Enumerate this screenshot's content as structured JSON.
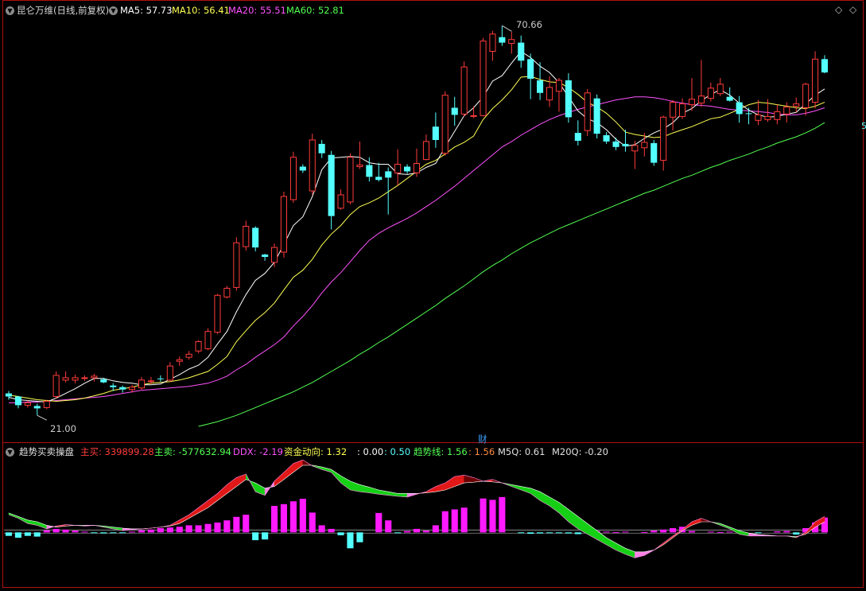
{
  "colors": {
    "up": "#ff3b3b",
    "down": "#54ffff",
    "ma5": "#ffffff",
    "ma10": "#ffff52",
    "ma20": "#ff52ff",
    "ma60": "#52ff52",
    "frame": "#b01010",
    "bg": "#000000"
  },
  "header": {
    "title": "昆仑万维(日线,前复权)",
    "ma5_label": "MA5:",
    "ma5_value": "57.73",
    "ma10_label": "MA10:",
    "ma10_value": "56.41",
    "ma20_label": "MA20:",
    "ma20_value": "55.51",
    "ma60_label": "MA60:",
    "ma60_value": "52.81"
  },
  "price_axis_mark": "5",
  "diamond_icon": "◇",
  "markers": {
    "high_label": "70.66",
    "low_label": "21.00",
    "event_label": "财"
  },
  "indicator_header": {
    "name": "趋势买卖操盘",
    "buy_label": "主买:",
    "buy_value": "339899.28",
    "sell_label": "主卖:",
    "sell_value": "-577632.94",
    "ddx_label": "DDX:",
    "ddx_value": "-2.19",
    "flow_label": "资金动向:",
    "flow_value": "1.32",
    "blank1_label": ":",
    "blank1_value": "0.00",
    "blank2_label": ":",
    "blank2_value": "0.50",
    "trend_label": "趋势线:",
    "trend_value": "1.56",
    "blank3_label": ":",
    "blank3_value": "1.56",
    "m5q_label": "M5Q:",
    "m5q_value": "0.61",
    "m20q_label": "M20Q:",
    "m20q_value": "-0.20"
  },
  "chart_data": {
    "type": "candlestick",
    "y_range": [
      19.4,
      71.3
    ],
    "ohlc": [
      [
        23.8,
        24.1,
        23.0,
        23.4
      ],
      [
        23.4,
        23.5,
        21.9,
        22.3
      ],
      [
        22.3,
        22.9,
        22.0,
        22.6
      ],
      [
        22.2,
        22.5,
        21.0,
        21.9
      ],
      [
        22.0,
        23.0,
        21.8,
        22.8
      ],
      [
        23.4,
        26.6,
        23.1,
        26.1
      ],
      [
        25.5,
        26.6,
        25.2,
        25.8
      ],
      [
        25.5,
        26.2,
        25.1,
        25.8
      ],
      [
        25.8,
        26.1,
        25.4,
        25.8
      ],
      [
        25.8,
        26.3,
        25.3,
        26.0
      ],
      [
        25.6,
        25.8,
        25.1,
        25.2
      ],
      [
        24.8,
        25.1,
        24.1,
        24.6
      ],
      [
        24.6,
        24.8,
        23.9,
        24.3
      ],
      [
        24.3,
        24.9,
        23.9,
        24.6
      ],
      [
        24.5,
        25.9,
        24.3,
        25.5
      ],
      [
        25.3,
        25.9,
        25.0,
        25.4
      ],
      [
        25.7,
        26.1,
        25.3,
        25.6
      ],
      [
        25.5,
        27.8,
        25.3,
        27.3
      ],
      [
        27.9,
        28.5,
        27.3,
        28.1
      ],
      [
        28.4,
        29.2,
        28.1,
        28.8
      ],
      [
        29.2,
        30.6,
        28.9,
        30.4
      ],
      [
        29.5,
        32.1,
        29.3,
        31.7
      ],
      [
        31.6,
        36.5,
        31.4,
        36.3
      ],
      [
        36.1,
        37.5,
        35.9,
        37.2
      ],
      [
        37.3,
        43.7,
        36.9,
        43.0
      ],
      [
        42.5,
        45.8,
        42.0,
        45.1
      ],
      [
        44.9,
        45.1,
        41.9,
        42.4
      ],
      [
        41.5,
        41.6,
        40.7,
        41.2
      ],
      [
        40.5,
        42.9,
        39.9,
        42.4
      ],
      [
        41.8,
        49.5,
        41.1,
        48.9
      ],
      [
        48.5,
        54.6,
        48.1,
        53.9
      ],
      [
        52.7,
        53.0,
        51.9,
        52.2
      ],
      [
        49.6,
        56.9,
        49.1,
        56.1
      ],
      [
        55.6,
        56.1,
        53.8,
        54.4
      ],
      [
        54.2,
        54.7,
        44.7,
        46.4
      ],
      [
        47.4,
        49.8,
        47.2,
        49.1
      ],
      [
        48.2,
        54.4,
        47.9,
        53.9
      ],
      [
        52.7,
        55.9,
        52.4,
        52.9
      ],
      [
        52.9,
        53.9,
        50.8,
        51.4
      ],
      [
        51.4,
        53.2,
        50.8,
        51.0
      ],
      [
        52.1,
        52.6,
        46.6,
        51.3
      ],
      [
        51.9,
        54.9,
        50.3,
        53.0
      ],
      [
        52.7,
        53.0,
        51.8,
        52.1
      ],
      [
        51.9,
        55.0,
        51.4,
        53.1
      ],
      [
        53.6,
        56.8,
        53.5,
        55.9
      ],
      [
        57.8,
        59.6,
        55.1,
        56.1
      ],
      [
        54.4,
        62.3,
        54.1,
        61.8
      ],
      [
        60.2,
        61.6,
        57.9,
        59.3
      ],
      [
        59.4,
        66.1,
        59.1,
        65.4
      ],
      [
        59.2,
        60.4,
        58.9,
        59.2
      ],
      [
        59.2,
        69.1,
        59.1,
        68.7
      ],
      [
        67.4,
        70.0,
        66.2,
        69.6
      ],
      [
        69.2,
        70.66,
        68.1,
        68.5
      ],
      [
        68.4,
        69.9,
        67.1,
        68.9
      ],
      [
        68.5,
        69.4,
        65.3,
        66.2
      ],
      [
        66.4,
        67.1,
        61.3,
        63.9
      ],
      [
        63.7,
        66.0,
        61.2,
        62.1
      ],
      [
        61.2,
        64.2,
        60.3,
        62.8
      ],
      [
        62.3,
        64.0,
        59.7,
        63.7
      ],
      [
        63.7,
        64.6,
        58.3,
        59.0
      ],
      [
        57.0,
        58.6,
        55.4,
        56.0
      ],
      [
        57.3,
        62.6,
        56.6,
        62.1
      ],
      [
        61.4,
        61.9,
        56.3,
        56.9
      ],
      [
        56.7,
        57.1,
        55.6,
        55.9
      ],
      [
        55.9,
        56.4,
        54.8,
        55.2
      ],
      [
        55.6,
        57.4,
        54.6,
        55.3
      ],
      [
        54.7,
        56.0,
        52.4,
        55.4
      ],
      [
        55.1,
        57.0,
        54.0,
        55.8
      ],
      [
        55.7,
        56.1,
        52.8,
        53.2
      ],
      [
        53.5,
        59.2,
        52.2,
        59.0
      ],
      [
        59.0,
        61.2,
        57.3,
        60.9
      ],
      [
        59.1,
        61.4,
        58.8,
        60.7
      ],
      [
        60.6,
        64.0,
        59.8,
        61.3
      ],
      [
        60.8,
        66.3,
        60.3,
        61.7
      ],
      [
        61.4,
        63.4,
        61.0,
        62.7
      ],
      [
        62.0,
        64.0,
        61.7,
        63.2
      ],
      [
        61.6,
        62.8,
        61.0,
        61.1
      ],
      [
        60.9,
        61.7,
        58.3,
        59.4
      ],
      [
        59.5,
        60.2,
        58.1,
        59.4
      ],
      [
        58.6,
        61.2,
        58.0,
        59.3
      ],
      [
        58.7,
        61.3,
        58.4,
        59.1
      ],
      [
        58.7,
        60.6,
        58.1,
        59.7
      ],
      [
        59.4,
        60.9,
        58.3,
        60.3
      ],
      [
        60.4,
        61.5,
        59.6,
        60.7
      ],
      [
        60.2,
        63.4,
        59.2,
        63.2
      ],
      [
        60.9,
        67.4,
        60.1,
        66.4
      ],
      [
        66.4,
        66.9,
        64.6,
        64.7
      ]
    ],
    "ma5": [
      23.3,
      23.0,
      22.9,
      22.8,
      22.7,
      23.2,
      23.8,
      24.4,
      25.1,
      25.7,
      25.7,
      25.4,
      25.2,
      25.1,
      24.9,
      24.9,
      25.0,
      25.6,
      26.2,
      26.9,
      27.4,
      28.4,
      30.1,
      31.7,
      34.2,
      36.4,
      38.2,
      39.1,
      40.5,
      42.8,
      45.2,
      46.3,
      48.9,
      52.3,
      53.8,
      53.9,
      54.0,
      53.9,
      53.2,
      53.0,
      53.0,
      51.8,
      51.7,
      51.9,
      52.6,
      53.1,
      55.2,
      57.2,
      59.2,
      60.2,
      61.6,
      63.6,
      64.3,
      65.9,
      67.4,
      66.6,
      65.5,
      64.7,
      63.4,
      61.6,
      59.8,
      58.8,
      58.3,
      57.4,
      56.2,
      55.3,
      55.5,
      56.3,
      57.0,
      57.5,
      58.3,
      59.5,
      60.1,
      61.1,
      61.9,
      62.5,
      61.8,
      60.8,
      59.9,
      59.3,
      59.0,
      59.1,
      59.4,
      59.6,
      60.7,
      61.8,
      62.6
    ],
    "ma10": [
      23.6,
      23.4,
      23.2,
      23.0,
      22.9,
      22.8,
      22.9,
      23.0,
      23.2,
      23.5,
      23.8,
      24.2,
      24.4,
      24.6,
      24.9,
      25.1,
      25.2,
      25.3,
      25.5,
      25.8,
      26.2,
      26.6,
      27.5,
      28.5,
      30.4,
      31.8,
      33.1,
      34.1,
      35.3,
      37.0,
      38.6,
      39.5,
      40.9,
      42.7,
      44.1,
      45.2,
      46.6,
      47.6,
      48.1,
      48.7,
      49.5,
      50.3,
      51.2,
      52.1,
      53.0,
      53.5,
      54.3,
      55.2,
      55.8,
      56.6,
      58.7,
      60.1,
      61.2,
      62.5,
      64.1,
      64.2,
      63.8,
      63.5,
      63.4,
      62.8,
      61.9,
      60.9,
      60.3,
      59.5,
      58.4,
      57.1,
      56.8,
      56.6,
      56.4,
      56.5,
      57.0,
      57.4,
      57.8,
      58.3,
      58.8,
      59.0,
      59.5,
      60.0,
      60.6,
      60.9,
      60.8,
      60.6,
      60.4,
      60.2,
      60.1,
      60.4,
      60.9
    ],
    "ma20": [
      22.6,
      22.6,
      22.7,
      22.7,
      22.8,
      22.9,
      23.0,
      23.1,
      23.2,
      23.3,
      23.4,
      23.6,
      23.8,
      24.0,
      24.2,
      24.3,
      24.4,
      24.5,
      24.6,
      24.7,
      24.9,
      25.1,
      25.5,
      26.0,
      26.8,
      27.5,
      28.4,
      29.2,
      30.0,
      31.0,
      32.4,
      33.6,
      35.0,
      36.6,
      38.0,
      39.2,
      40.6,
      42.0,
      43.3,
      44.2,
      44.9,
      45.5,
      46.1,
      46.8,
      47.6,
      48.4,
      49.3,
      50.2,
      51.2,
      52.2,
      53.2,
      54.2,
      55.2,
      55.9,
      56.7,
      57.4,
      58.1,
      58.7,
      59.2,
      59.6,
      60.0,
      60.3,
      60.6,
      60.9,
      61.2,
      61.4,
      61.6,
      61.6,
      61.5,
      61.3,
      61.0,
      60.8,
      60.6,
      60.5,
      60.4,
      60.2,
      60.0,
      59.9,
      59.8,
      59.7,
      59.6,
      59.4,
      59.3,
      59.3,
      59.5,
      59.8,
      60.2
    ],
    "ma60": [
      null,
      null,
      null,
      null,
      null,
      null,
      null,
      null,
      null,
      null,
      null,
      null,
      null,
      null,
      null,
      null,
      null,
      null,
      null,
      null,
      19.6,
      19.9,
      20.2,
      20.6,
      21.0,
      21.5,
      22.0,
      22.5,
      23.0,
      23.5,
      24.0,
      24.6,
      25.2,
      25.9,
      26.6,
      27.3,
      28.0,
      28.8,
      29.5,
      30.3,
      31.0,
      31.8,
      32.6,
      33.4,
      34.2,
      35.0,
      35.9,
      36.7,
      37.5,
      38.4,
      39.3,
      40.1,
      40.8,
      41.6,
      42.3,
      43.0,
      43.6,
      44.2,
      44.8,
      45.3,
      45.8,
      46.3,
      46.8,
      47.3,
      47.8,
      48.3,
      48.8,
      49.3,
      49.7,
      50.2,
      50.7,
      51.2,
      51.6,
      52.1,
      52.6,
      53.0,
      53.5,
      53.9,
      54.3,
      54.8,
      55.2,
      55.7,
      56.1,
      56.5,
      57.0,
      57.6,
      58.3
    ],
    "indicator": {
      "y_range": [
        -1.5,
        2.1
      ],
      "bars": [
        -0.1,
        -0.15,
        -0.1,
        -0.12,
        0.06,
        0.1,
        0.08,
        0.05,
        0.02,
        -0.02,
        -0.03,
        -0.02,
        -0.01,
        0.02,
        0.06,
        0.08,
        0.12,
        0.14,
        0.16,
        0.2,
        0.2,
        0.24,
        0.28,
        0.34,
        0.44,
        0.5,
        -0.22,
        -0.2,
        0.75,
        0.8,
        0.88,
        0.95,
        0.56,
        0.2,
        0.1,
        -0.08,
        -0.45,
        -0.28,
        0.0,
        0.55,
        0.34,
        -0.02,
        0.04,
        0.1,
        0.05,
        0.2,
        0.6,
        0.65,
        0.7,
        0.0,
        0.96,
        0.92,
        1.0,
        0.0,
        -0.02,
        -0.04,
        -0.03,
        -0.02,
        -0.02,
        -0.03,
        -0.05,
        0.01,
        0.04,
        0.02,
        0.01,
        0.02,
        0.0,
        0.01,
        0.05,
        0.08,
        0.12,
        0.16,
        0.04,
        0.0,
        0.02,
        0.01,
        0.02,
        0.0,
        0.0,
        -0.02,
        0.0,
        0.03,
        0.04,
        -0.06,
        0.12,
        0.28,
        0.42
      ],
      "main": [
        0.5,
        0.4,
        0.25,
        0.2,
        0.1,
        0.18,
        0.22,
        0.2,
        0.18,
        0.2,
        0.15,
        0.1,
        0.05,
        0.08,
        0.1,
        0.12,
        0.15,
        0.2,
        0.35,
        0.5,
        0.7,
        0.9,
        1.1,
        1.35,
        1.55,
        1.65,
        1.15,
        1.05,
        1.45,
        1.7,
        1.95,
        2.05,
        1.88,
        1.78,
        1.7,
        1.4,
        1.2,
        1.15,
        1.12,
        1.08,
        1.05,
        1.02,
        1.0,
        1.08,
        1.15,
        1.3,
        1.4,
        1.58,
        1.62,
        1.55,
        1.45,
        1.5,
        1.4,
        1.3,
        1.2,
        1.1,
        0.9,
        0.75,
        0.55,
        0.3,
        0.1,
        -0.05,
        -0.2,
        -0.35,
        -0.5,
        -0.62,
        -0.72,
        -0.65,
        -0.5,
        -0.3,
        -0.1,
        0.08,
        0.3,
        0.4,
        0.3,
        0.2,
        0.1,
        -0.05,
        -0.1,
        -0.1,
        -0.1,
        -0.1,
        -0.1,
        -0.15,
        0.0,
        0.3,
        0.45
      ],
      "signal": [
        0.55,
        0.45,
        0.35,
        0.3,
        0.2,
        0.15,
        0.18,
        0.2,
        0.2,
        0.2,
        0.18,
        0.15,
        0.12,
        0.1,
        0.1,
        0.12,
        0.15,
        0.18,
        0.25,
        0.4,
        0.55,
        0.7,
        0.9,
        1.1,
        1.3,
        1.5,
        1.4,
        1.25,
        1.3,
        1.5,
        1.7,
        1.9,
        1.9,
        1.85,
        1.78,
        1.6,
        1.45,
        1.35,
        1.28,
        1.2,
        1.15,
        1.1,
        1.1,
        1.1,
        1.12,
        1.15,
        1.2,
        1.3,
        1.4,
        1.42,
        1.45,
        1.43,
        1.4,
        1.35,
        1.3,
        1.25,
        1.15,
        1.0,
        0.85,
        0.65,
        0.45,
        0.25,
        0.05,
        -0.15,
        -0.3,
        -0.45,
        -0.55,
        -0.55,
        -0.5,
        -0.35,
        -0.15,
        0.05,
        0.2,
        0.3,
        0.3,
        0.25,
        0.15,
        0.05,
        -0.02,
        -0.06,
        -0.08,
        -0.1,
        -0.1,
        -0.12,
        -0.05,
        0.15,
        0.3
      ],
      "baseline": 0.0
    }
  }
}
